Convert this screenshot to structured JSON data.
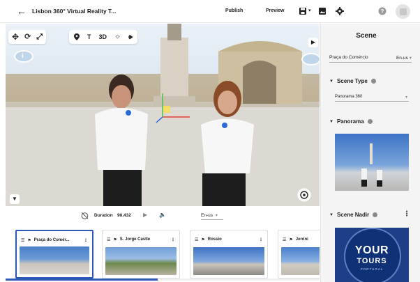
{
  "topbar": {
    "title": "Lisbon 360° Virtual Reality T...",
    "publish_label": "Publish",
    "preview_label": "Preview",
    "icons": [
      "back-arrow-icon",
      "save-icon",
      "dropdown-caret-icon",
      "image-icon",
      "gear-icon",
      "help-icon",
      "avatar-icon"
    ]
  },
  "viewer": {
    "tools_left": [
      "move-icon",
      "rotate-icon",
      "scale-icon"
    ],
    "tools_right": [
      "pin-icon",
      "T",
      "3D",
      "sun-icon",
      "sound-icon"
    ]
  },
  "duration": {
    "label": "Duration",
    "value": "90,432",
    "language": "En-us"
  },
  "scenes": [
    {
      "name": "Praça do Comér...",
      "active": true
    },
    {
      "name": "S. Jorge Castle",
      "active": false
    },
    {
      "name": "Rossio",
      "active": false
    },
    {
      "name": "Jeróni",
      "active": false
    }
  ],
  "panel": {
    "title": "Scene",
    "scene_name": "Praça do Comércio",
    "language": "En-us",
    "scene_type_label": "Scene Type",
    "scene_type_value": "Panorama 360",
    "panorama_label": "Panorama",
    "scene_nadir_label": "Scene Nadir",
    "nadir_logo": {
      "line1": "YOUR",
      "line2": "TOURS",
      "line3": "PORTUGAL"
    }
  },
  "colors": {
    "accent": "#2b58b8",
    "panel_bg": "#f4f4f4"
  }
}
